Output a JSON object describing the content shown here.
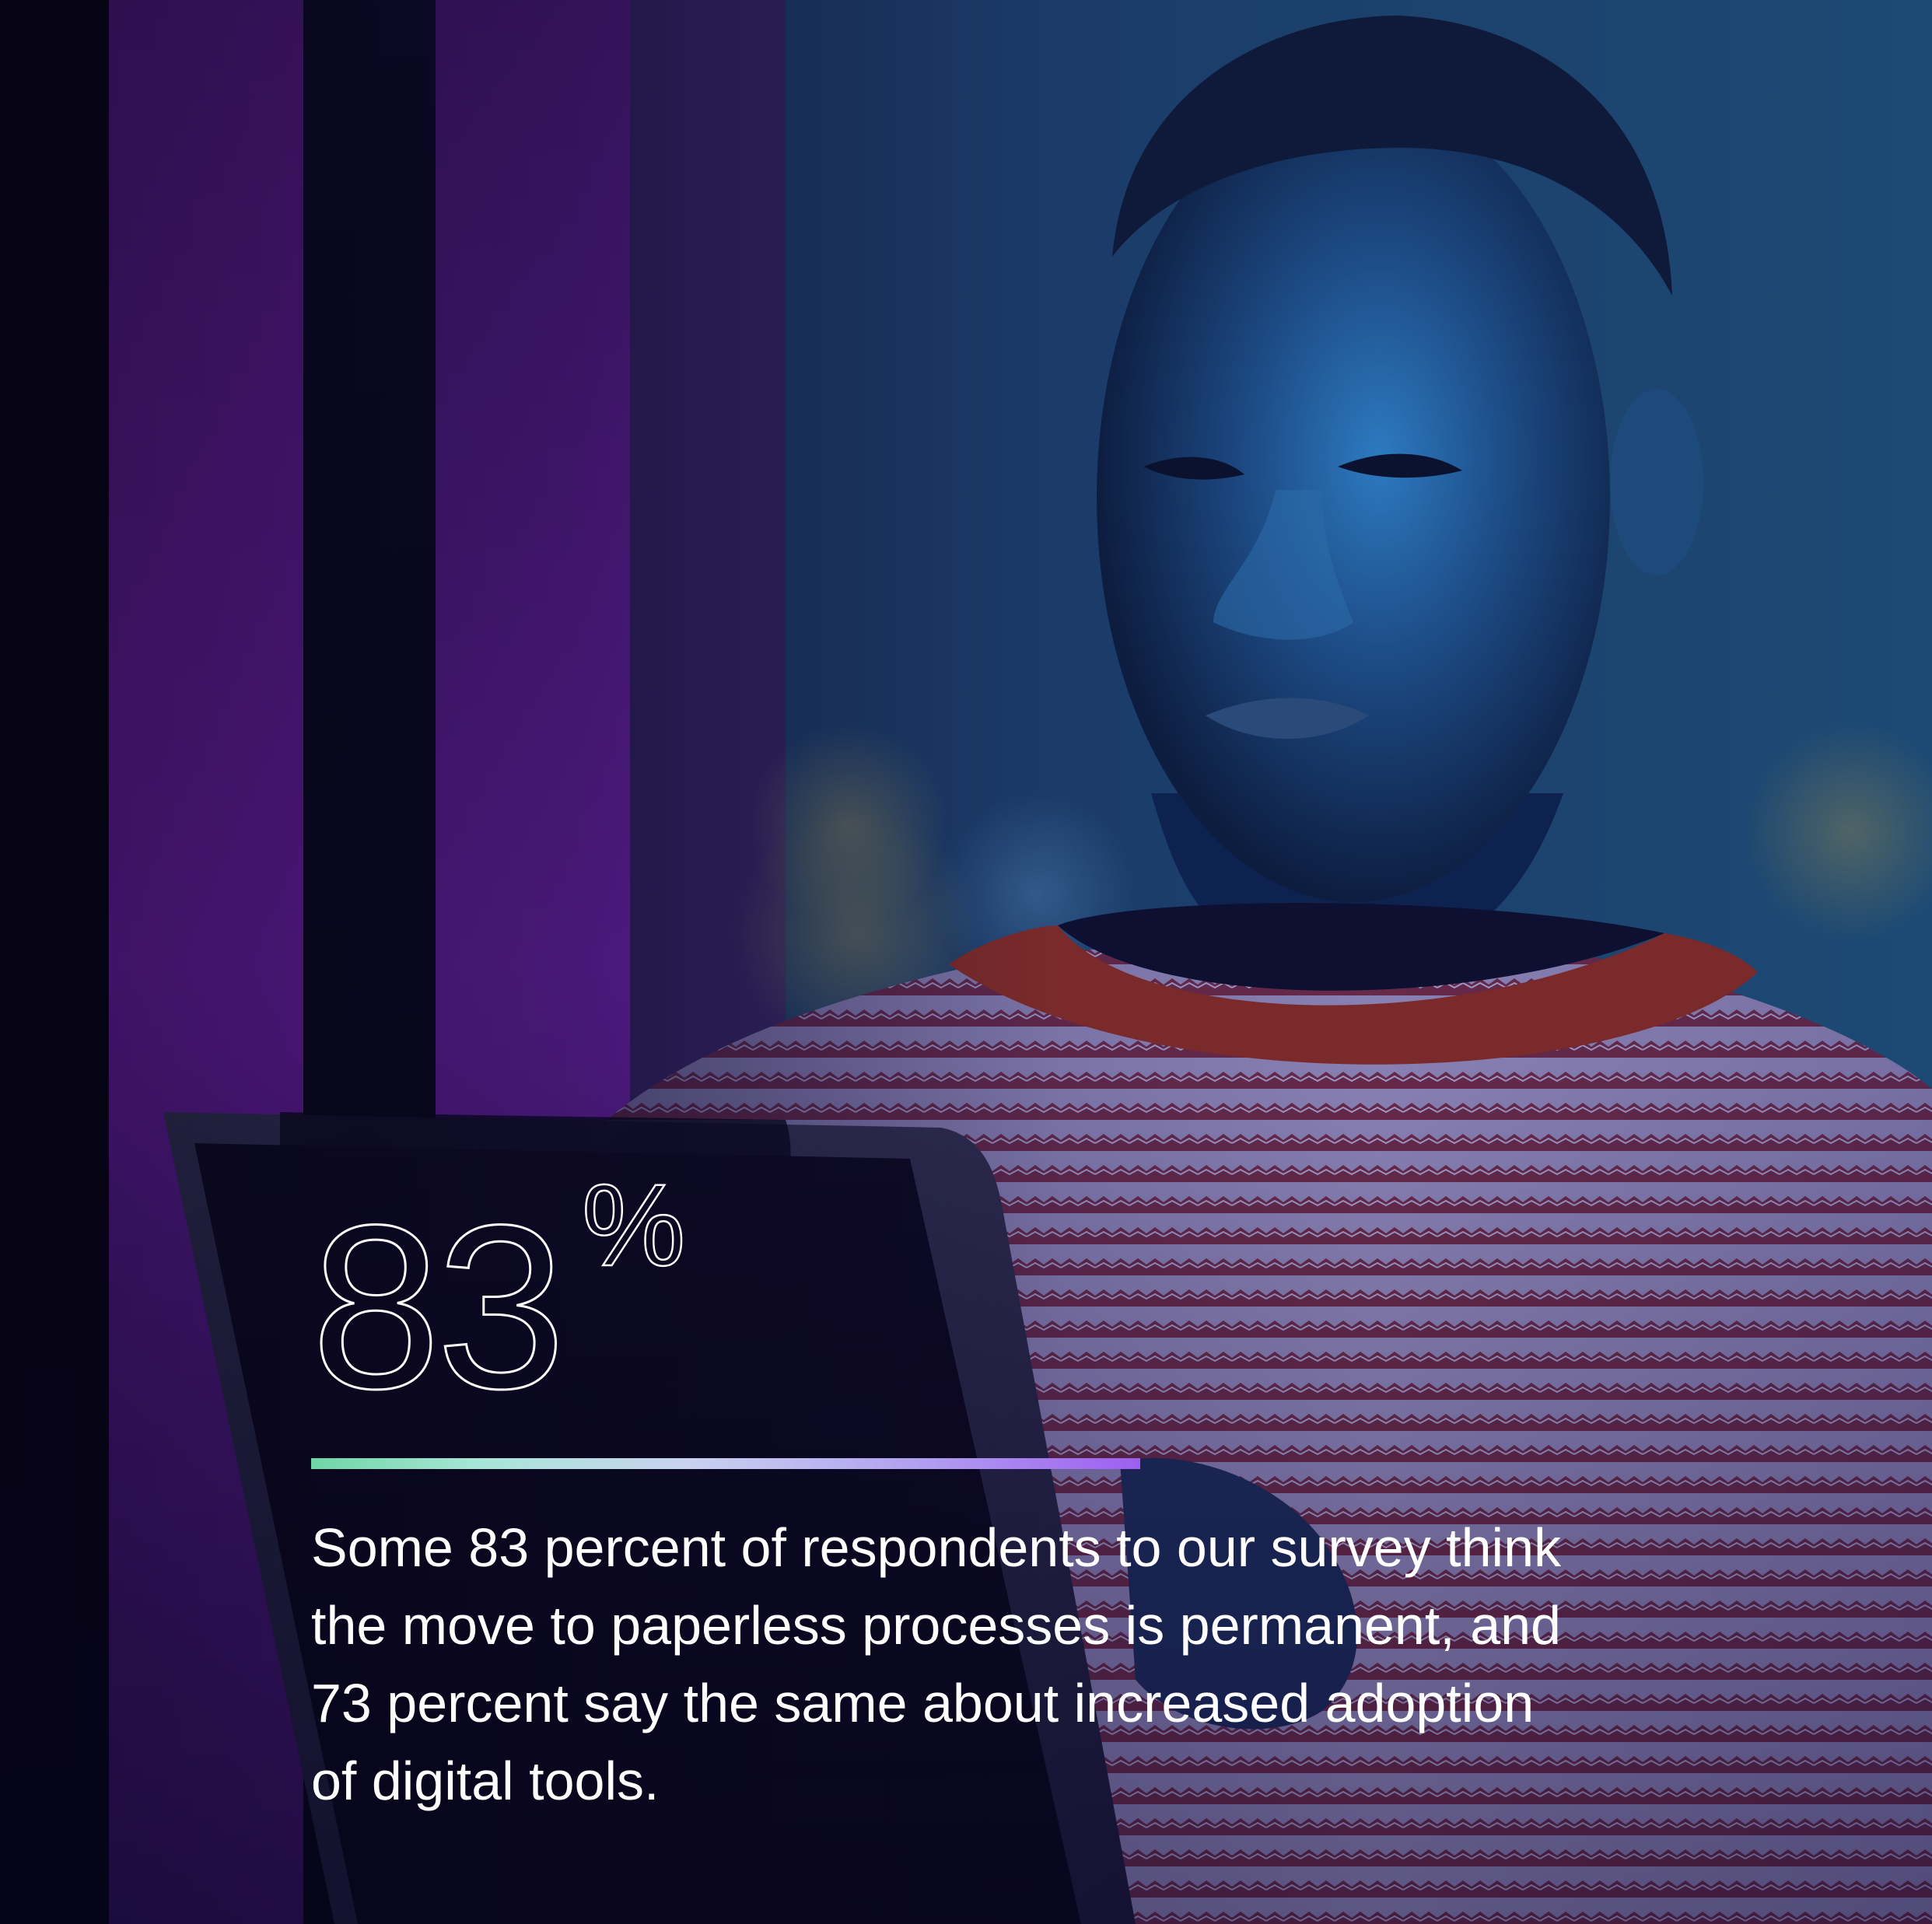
{
  "stat": {
    "number": "83",
    "unit": "%"
  },
  "caption": "Some 83 percent of respondents to our survey think the move to paperless processes is permanent, and 73 percent say the same about increased adoption of digital tools.",
  "colors": {
    "gradient_start": "#6fd6a6",
    "gradient_end": "#9d5ef0",
    "text": "#ffffff"
  }
}
